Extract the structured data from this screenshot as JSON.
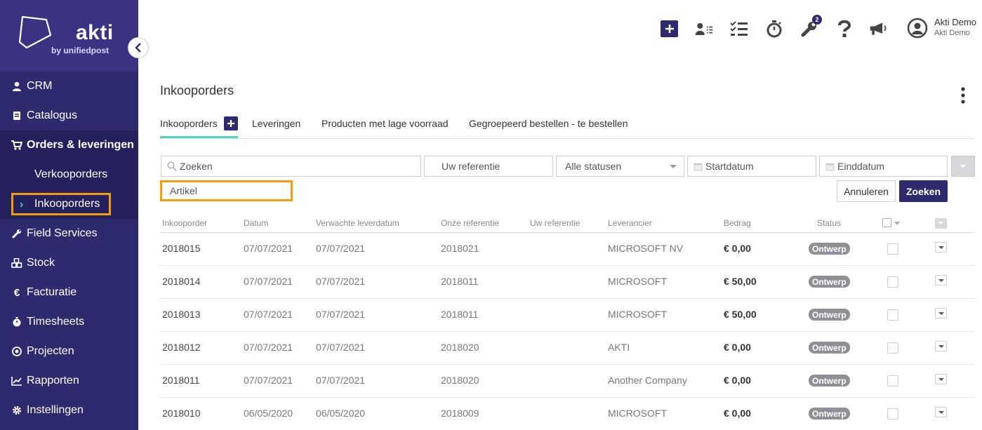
{
  "brand": {
    "name": "akti",
    "sub": "by unifiedpost"
  },
  "sidebar": {
    "items": [
      {
        "label": "CRM",
        "icon": "user-icon"
      },
      {
        "label": "Catalogus",
        "icon": "book-icon"
      },
      {
        "label": "Orders & leveringen",
        "icon": "cart-icon",
        "active": true
      },
      {
        "label": "Field Services",
        "icon": "wrench-icon"
      },
      {
        "label": "Stock",
        "icon": "cubes-icon"
      },
      {
        "label": "Facturatie",
        "icon": "euro-icon"
      },
      {
        "label": "Timesheets",
        "icon": "stopwatch-icon"
      },
      {
        "label": "Projecten",
        "icon": "target-icon"
      },
      {
        "label": "Rapporten",
        "icon": "chart-icon"
      },
      {
        "label": "Instellingen",
        "icon": "gear-icon"
      }
    ],
    "subitems": [
      {
        "label": "Verkooporders"
      },
      {
        "label": "Inkooporders",
        "current": true
      }
    ]
  },
  "topbar": {
    "badge_count": "2",
    "user_name": "Akti Demo",
    "user_company": "Akti Demo"
  },
  "page": {
    "title": "Inkooporders",
    "tabs": [
      {
        "label": "Inkooporders",
        "active": true
      },
      {
        "label": "Leveringen"
      },
      {
        "label": "Producten met lage voorraad"
      },
      {
        "label": "Gegroepeerd bestellen - te bestellen"
      }
    ]
  },
  "filters": {
    "search_placeholder": "Zoeken",
    "reference_placeholder": "Uw referentie",
    "status_value": "Alle statusen",
    "start_placeholder": "Startdatum",
    "end_placeholder": "Einddatum",
    "article_placeholder": "Artikel",
    "cancel_label": "Annuleren",
    "search_label": "Zoeken"
  },
  "table": {
    "columns": [
      "Inkooporder",
      "Datum",
      "Verwachte leverdatum",
      "Onze referentie",
      "Uw referentie",
      "Leverancier",
      "Bedrag",
      "Status"
    ],
    "rows": [
      {
        "order": "2018015",
        "date": "07/07/2021",
        "expected": "07/07/2021",
        "our_ref": "2018021",
        "your_ref": "",
        "supplier": "MICROSOFT NV",
        "amount": "€ 0,00",
        "status": "Ontwerp"
      },
      {
        "order": "2018014",
        "date": "07/07/2021",
        "expected": "07/07/2021",
        "our_ref": "2018011",
        "your_ref": "",
        "supplier": "MICROSOFT",
        "amount": "€ 50,00",
        "status": "Ontwerp"
      },
      {
        "order": "2018013",
        "date": "07/07/2021",
        "expected": "07/07/2021",
        "our_ref": "2018011",
        "your_ref": "",
        "supplier": "MICROSOFT",
        "amount": "€ 50,00",
        "status": "Ontwerp"
      },
      {
        "order": "2018012",
        "date": "07/07/2021",
        "expected": "07/07/2021",
        "our_ref": "2018020",
        "your_ref": "",
        "supplier": "AKTI",
        "amount": "€ 0,00",
        "status": "Ontwerp"
      },
      {
        "order": "2018011",
        "date": "07/07/2021",
        "expected": "07/07/2021",
        "our_ref": "2018020",
        "your_ref": "",
        "supplier": "Another Company",
        "amount": "€ 0,00",
        "status": "Ontwerp"
      },
      {
        "order": "2018010",
        "date": "06/05/2020",
        "expected": "06/05/2020",
        "our_ref": "2018009",
        "your_ref": "",
        "supplier": "MICROSOFT",
        "amount": "€ 0,00",
        "status": "Ontwerp"
      }
    ]
  },
  "colors": {
    "primary": "#2e2a6e",
    "accent": "#4fd1c5",
    "highlight": "#f39c12",
    "status_grey": "#8e9095"
  }
}
